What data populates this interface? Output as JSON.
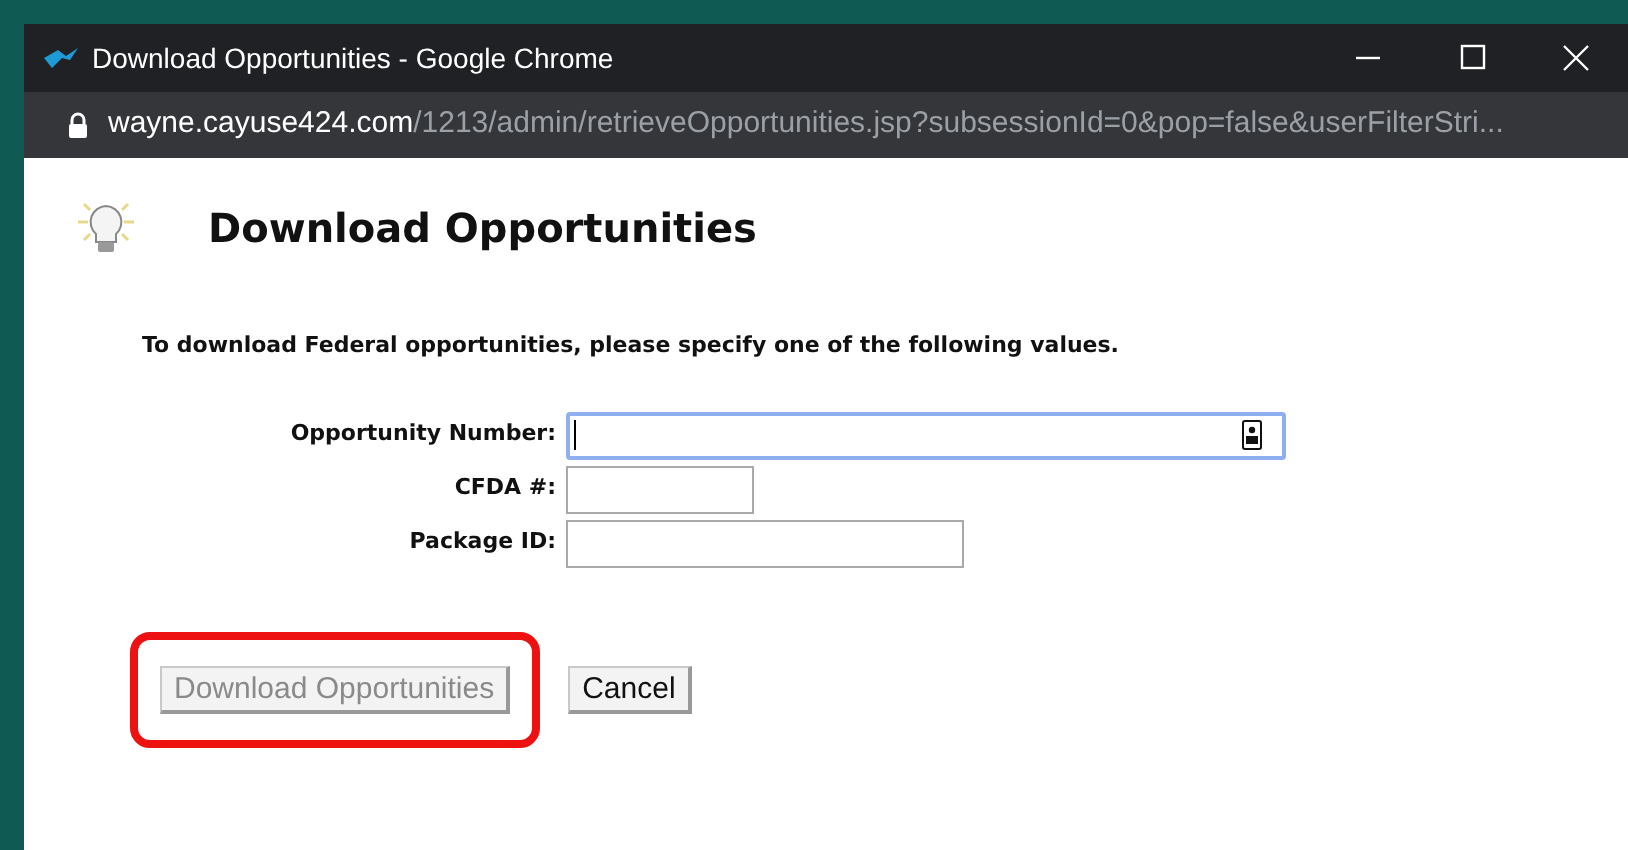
{
  "window": {
    "title": "Download Opportunities - Google Chrome"
  },
  "address_bar": {
    "host": "wayne.cayuse424.com",
    "path": "/1213/admin/retrieveOpportunities.jsp?subsessionId=0&pop=false&userFilterStri..."
  },
  "page": {
    "heading": "Download Opportunities",
    "instructions": "To download Federal opportunities, please specify one of the following values.",
    "fields": [
      {
        "label": "Opportunity Number:",
        "focused": true
      },
      {
        "label": "CFDA #:",
        "focused": false
      },
      {
        "label": "Package ID:",
        "focused": false
      }
    ],
    "buttons": [
      {
        "label": "Download Opportunities",
        "disabled": true,
        "highlighted": true
      },
      {
        "label": "Cancel",
        "disabled": false,
        "highlighted": false
      }
    ]
  }
}
